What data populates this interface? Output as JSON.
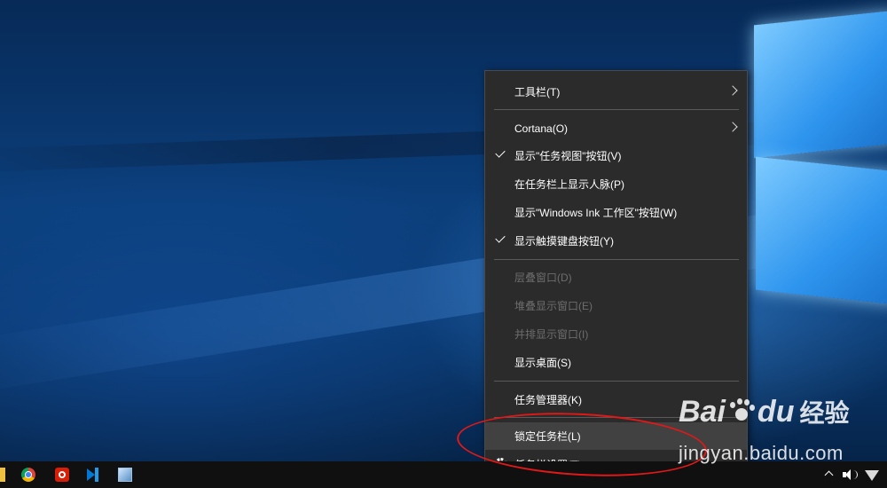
{
  "context_menu": {
    "items": [
      {
        "label": "工具栏(T)",
        "checked": false,
        "submenu": true,
        "enabled": true
      },
      {
        "label": "Cortana(O)",
        "checked": false,
        "submenu": true,
        "enabled": true
      },
      {
        "label": "显示\"任务视图\"按钮(V)",
        "checked": true,
        "submenu": false,
        "enabled": true
      },
      {
        "label": "在任务栏上显示人脉(P)",
        "checked": false,
        "submenu": false,
        "enabled": true
      },
      {
        "label": "显示\"Windows Ink 工作区\"按钮(W)",
        "checked": false,
        "submenu": false,
        "enabled": true
      },
      {
        "label": "显示触摸键盘按钮(Y)",
        "checked": true,
        "submenu": false,
        "enabled": true
      },
      {
        "label": "层叠窗口(D)",
        "checked": false,
        "submenu": false,
        "enabled": false
      },
      {
        "label": "堆叠显示窗口(E)",
        "checked": false,
        "submenu": false,
        "enabled": false
      },
      {
        "label": "并排显示窗口(I)",
        "checked": false,
        "submenu": false,
        "enabled": false
      },
      {
        "label": "显示桌面(S)",
        "checked": false,
        "submenu": false,
        "enabled": true
      },
      {
        "label": "任务管理器(K)",
        "checked": false,
        "submenu": false,
        "enabled": true
      },
      {
        "label": "锁定任务栏(L)",
        "checked": false,
        "submenu": false,
        "enabled": true,
        "highlighted": true
      },
      {
        "label": "任务栏设置(T)",
        "checked": false,
        "submenu": false,
        "enabled": true,
        "icon": "gear-icon"
      }
    ]
  },
  "taskbar": {
    "apps": [
      "folder-icon",
      "chrome-icon",
      "netease-music-icon",
      "vscode-icon",
      "app-icon"
    ],
    "tray": [
      "chevron-up-icon",
      "volume-icon",
      "wifi-icon"
    ]
  },
  "watermark": {
    "logo_text_left": "Bai",
    "logo_text_right": "du",
    "logo_chinese": "经验",
    "url": "jingyan.baidu.com"
  },
  "colors": {
    "menu_bg": "#2b2b2b",
    "menu_highlight": "#414141",
    "disabled_text": "#6d6d6d",
    "annotation": "#e01818",
    "taskbar_bg": "#101010"
  }
}
